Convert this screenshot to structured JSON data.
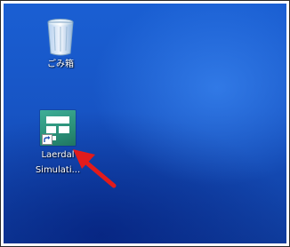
{
  "desktop": {
    "icons": [
      {
        "label": "ごみ箱",
        "icon": "recycle-bin-icon"
      },
      {
        "label_line1": "Laerdal",
        "label_line2": "Simulati...",
        "icon": "laerdal-app-icon",
        "badge": "shortcut-arrow-icon"
      }
    ],
    "annotation": {
      "icon": "red-arrow-icon",
      "color": "#e21b1b"
    }
  }
}
